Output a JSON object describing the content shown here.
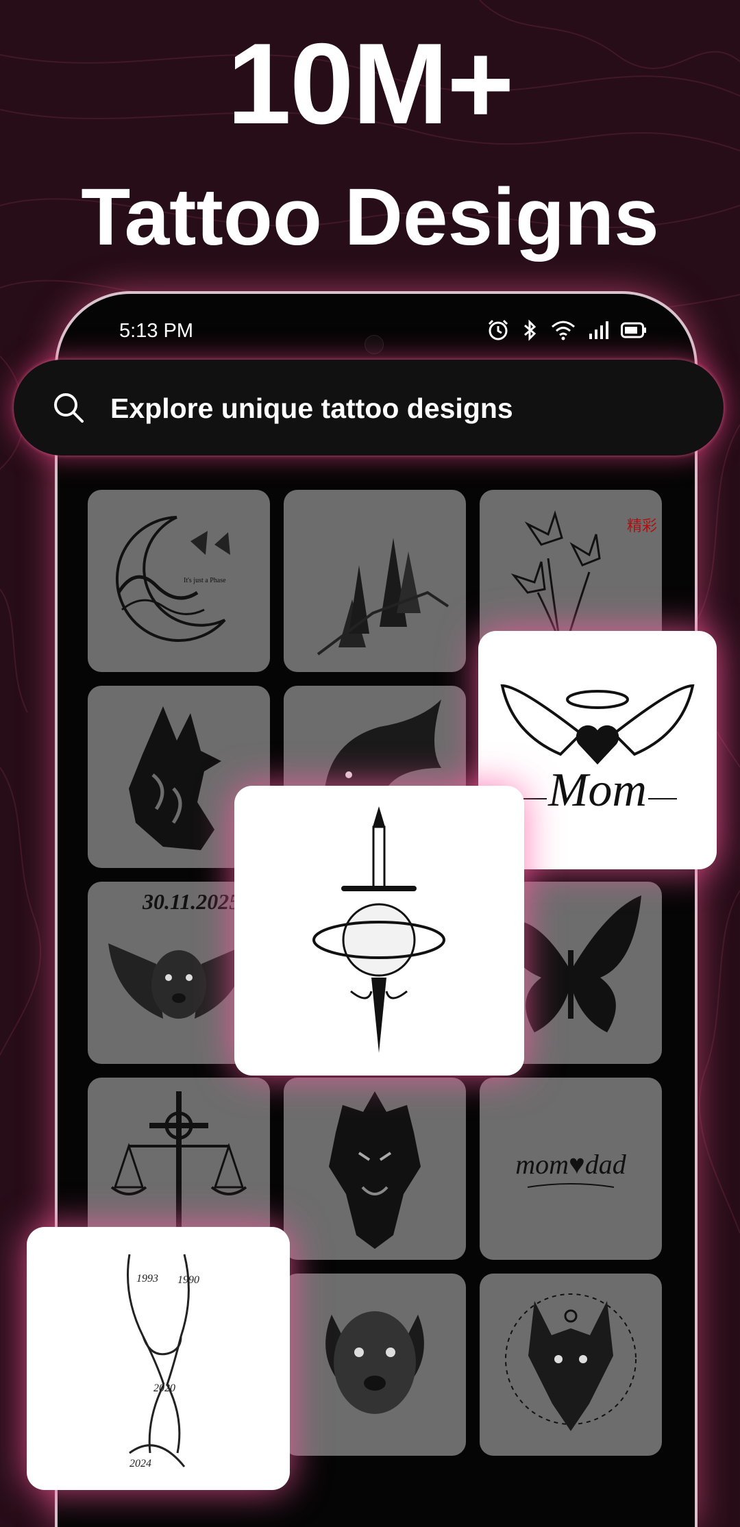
{
  "headline": {
    "line1": "10M+",
    "line2": "Tattoo Designs"
  },
  "status_bar": {
    "time": "5:13 PM",
    "icons": [
      "alarm-icon",
      "bluetooth-icon",
      "wifi-icon",
      "signal-icon",
      "battery-icon"
    ]
  },
  "search": {
    "placeholder": "Explore unique tattoo designs",
    "icon": "search-icon"
  },
  "tiles": [
    {
      "name": "moon-wave-butterfly",
      "text": "It's just a Phase"
    },
    {
      "name": "pine-trees-mountain"
    },
    {
      "name": "lilies-kanji",
      "text": "精彩"
    },
    {
      "name": "tribal-wolf"
    },
    {
      "name": "eagle-head"
    },
    {
      "name": "winged-dog",
      "text": "30.11.2025"
    },
    {
      "name": "scales-cross"
    },
    {
      "name": "tribal-lion"
    },
    {
      "name": "mom-dad-script",
      "text": "mom♥dad"
    },
    {
      "name": "dog-portrait"
    },
    {
      "name": "wolf-mandala"
    },
    {
      "name": "butterfly-tribal"
    }
  ],
  "featured": [
    {
      "name": "mom-angel-wings",
      "text": "Mom"
    },
    {
      "name": "sword-planet"
    },
    {
      "name": "holding-hands",
      "years": [
        "1993",
        "1990",
        "2020",
        "2024"
      ]
    }
  ],
  "colors": {
    "background": "#260d18",
    "accent_glow": "#ff5a96",
    "tile": "#6d6d6d"
  }
}
